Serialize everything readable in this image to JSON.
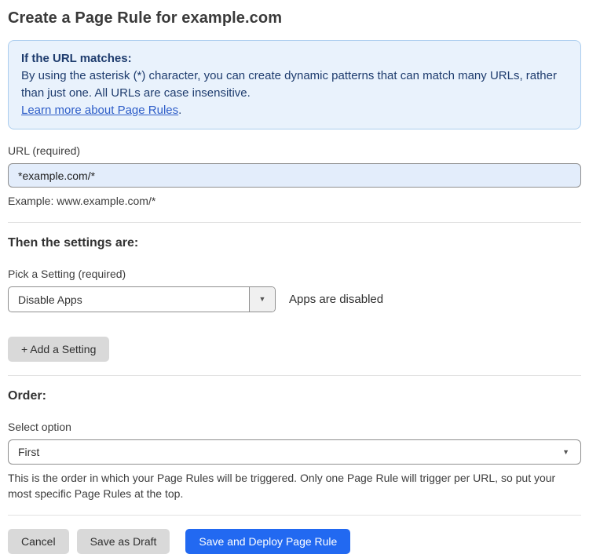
{
  "page": {
    "title": "Create a Page Rule for example.com"
  },
  "info_box": {
    "heading": "If the URL matches:",
    "body": "By using the asterisk (*) character, you can create dynamic patterns that can match many URLs, rather than just one. All URLs are case insensitive.",
    "link_label": "Learn more about Page Rules",
    "link_suffix": "."
  },
  "url_field": {
    "label": "URL (required)",
    "value": "*example.com/*",
    "helper": "Example: www.example.com/*"
  },
  "settings_section": {
    "heading": "Then the settings are:",
    "picker_label": "Pick a Setting (required)",
    "selected_setting": "Disable Apps",
    "dropdown_caret": "▼",
    "status_text": "Apps are disabled",
    "add_button_label": "+ Add a Setting"
  },
  "order_section": {
    "heading": "Order:",
    "select_label": "Select option",
    "selected_option": "First",
    "dropdown_caret": "▼",
    "helper": "This is the order in which your Page Rules will be triggered. Only one Page Rule will trigger per URL, so put your most specific Page Rules at the top."
  },
  "footer": {
    "cancel_label": "Cancel",
    "save_draft_label": "Save as Draft",
    "save_deploy_label": "Save and Deploy Page Rule"
  },
  "colors": {
    "accent_blue": "#2269f1",
    "info_background": "#e9f2fc",
    "info_border": "#abcdee",
    "info_text": "#1e3c6e",
    "link_blue": "#2d5dc8",
    "input_background": "#e3edfb",
    "button_gray": "#d9d9d9"
  }
}
